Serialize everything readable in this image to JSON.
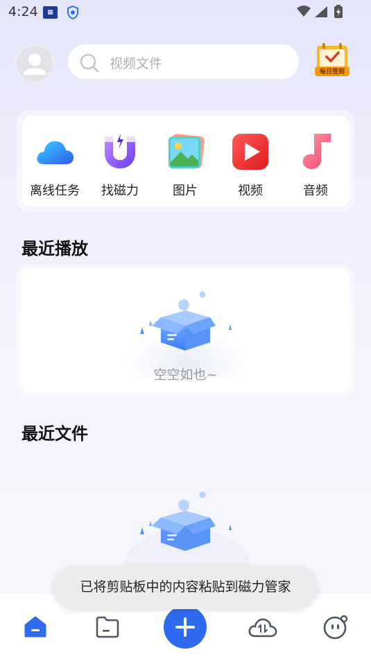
{
  "status_bar": {
    "time": "4:24"
  },
  "header": {
    "search_placeholder": "视频文件",
    "checkin_label": "每日签到"
  },
  "quick_actions": [
    {
      "label": "离线任务",
      "icon": "cloud-icon"
    },
    {
      "label": "找磁力",
      "icon": "magnet-icon"
    },
    {
      "label": "图片",
      "icon": "image-icon"
    },
    {
      "label": "视频",
      "icon": "play-icon"
    },
    {
      "label": "音频",
      "icon": "music-note-icon"
    }
  ],
  "recent_play": {
    "title": "最近播放",
    "empty_text": "空空如也~"
  },
  "recent_files": {
    "title": "最近文件"
  },
  "toast": {
    "text": "已将剪贴板中的内容粘贴到磁力管家"
  },
  "bottom_nav": [
    {
      "icon": "home-icon",
      "active": true
    },
    {
      "icon": "folder-icon",
      "active": false
    },
    {
      "icon": "add-icon",
      "active": false
    },
    {
      "icon": "cloud-transfer-icon",
      "active": false
    },
    {
      "icon": "profile-icon",
      "active": false
    }
  ],
  "colors": {
    "accent": "#2f6bf0",
    "inactive": "#4b5563"
  }
}
